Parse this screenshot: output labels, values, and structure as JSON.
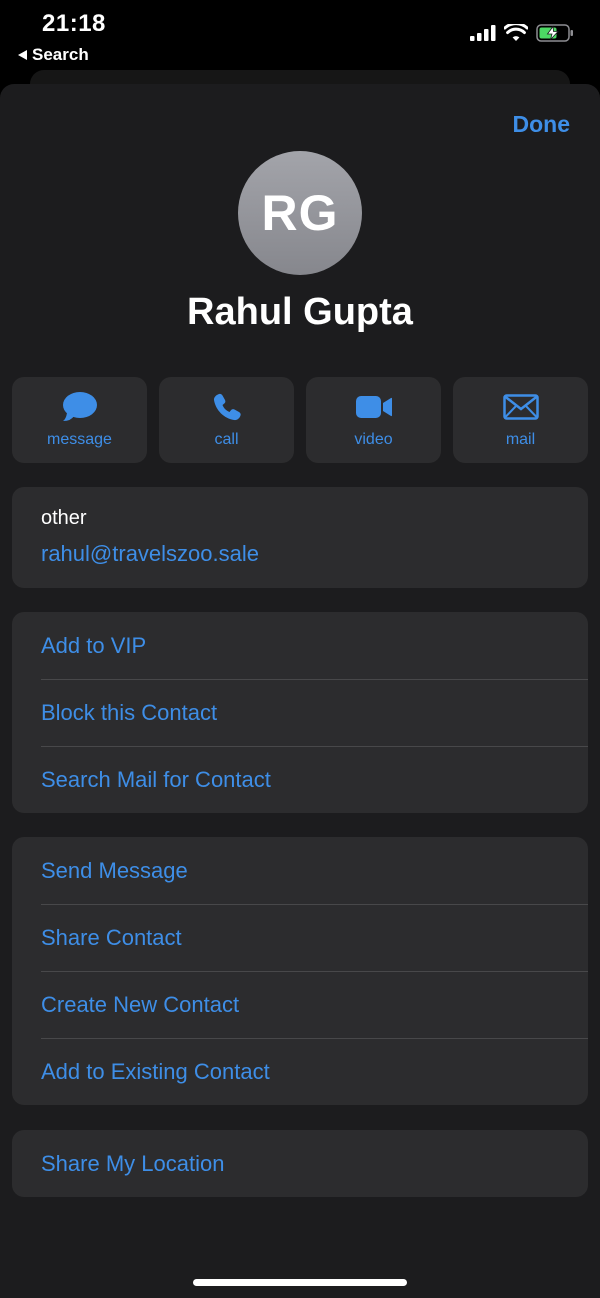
{
  "status_bar": {
    "time": "21:18",
    "back_label": "Search"
  },
  "header": {
    "done_label": "Done"
  },
  "contact": {
    "initials": "RG",
    "name": "Rahul Gupta"
  },
  "actions": [
    {
      "label": "message",
      "icon": "message-bubble-icon"
    },
    {
      "label": "call",
      "icon": "phone-icon"
    },
    {
      "label": "video",
      "icon": "video-camera-icon"
    },
    {
      "label": "mail",
      "icon": "envelope-icon"
    }
  ],
  "email": {
    "label": "other",
    "value": "rahul@travelszoo.sale"
  },
  "group1": [
    "Add to VIP",
    "Block this Contact",
    "Search Mail for Contact"
  ],
  "group2": [
    "Send Message",
    "Share Contact",
    "Create New Contact",
    "Add to Existing Contact"
  ],
  "group3": [
    "Share My Location"
  ],
  "colors": {
    "accent": "#3e8ee7",
    "sheet_bg": "#1c1c1e",
    "card_bg": "#2c2c2e",
    "battery_charging": "#4cd964"
  }
}
